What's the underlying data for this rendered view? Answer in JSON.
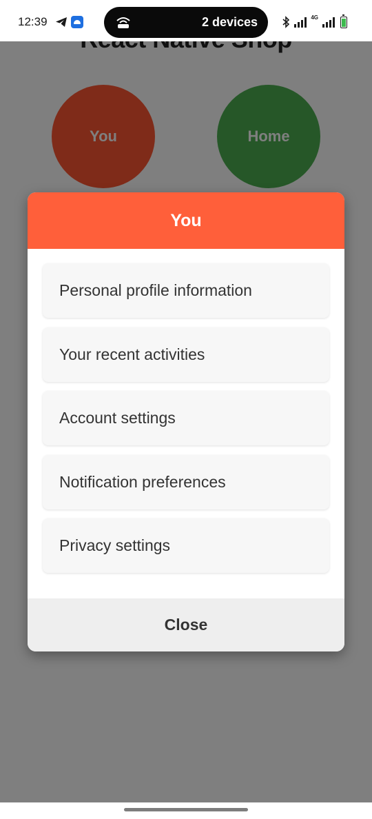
{
  "status_bar": {
    "time": "12:39",
    "network": "4G",
    "island_text": "2 devices",
    "icons": [
      "telegram-icon",
      "android-app-icon",
      "hotspot-icon",
      "bluetooth-icon",
      "signal-icon",
      "battery-icon"
    ]
  },
  "app": {
    "title": "React Native Shop",
    "circles": [
      {
        "label": "You",
        "color": "#ff5733"
      },
      {
        "label": "Home",
        "color": "#4caf50"
      }
    ]
  },
  "modal": {
    "title": "You",
    "header_color": "#ff5f3a",
    "items": [
      {
        "label": "Personal profile information"
      },
      {
        "label": "Your recent activities"
      },
      {
        "label": "Account settings"
      },
      {
        "label": "Notification preferences"
      },
      {
        "label": "Privacy settings"
      }
    ],
    "close_label": "Close"
  }
}
